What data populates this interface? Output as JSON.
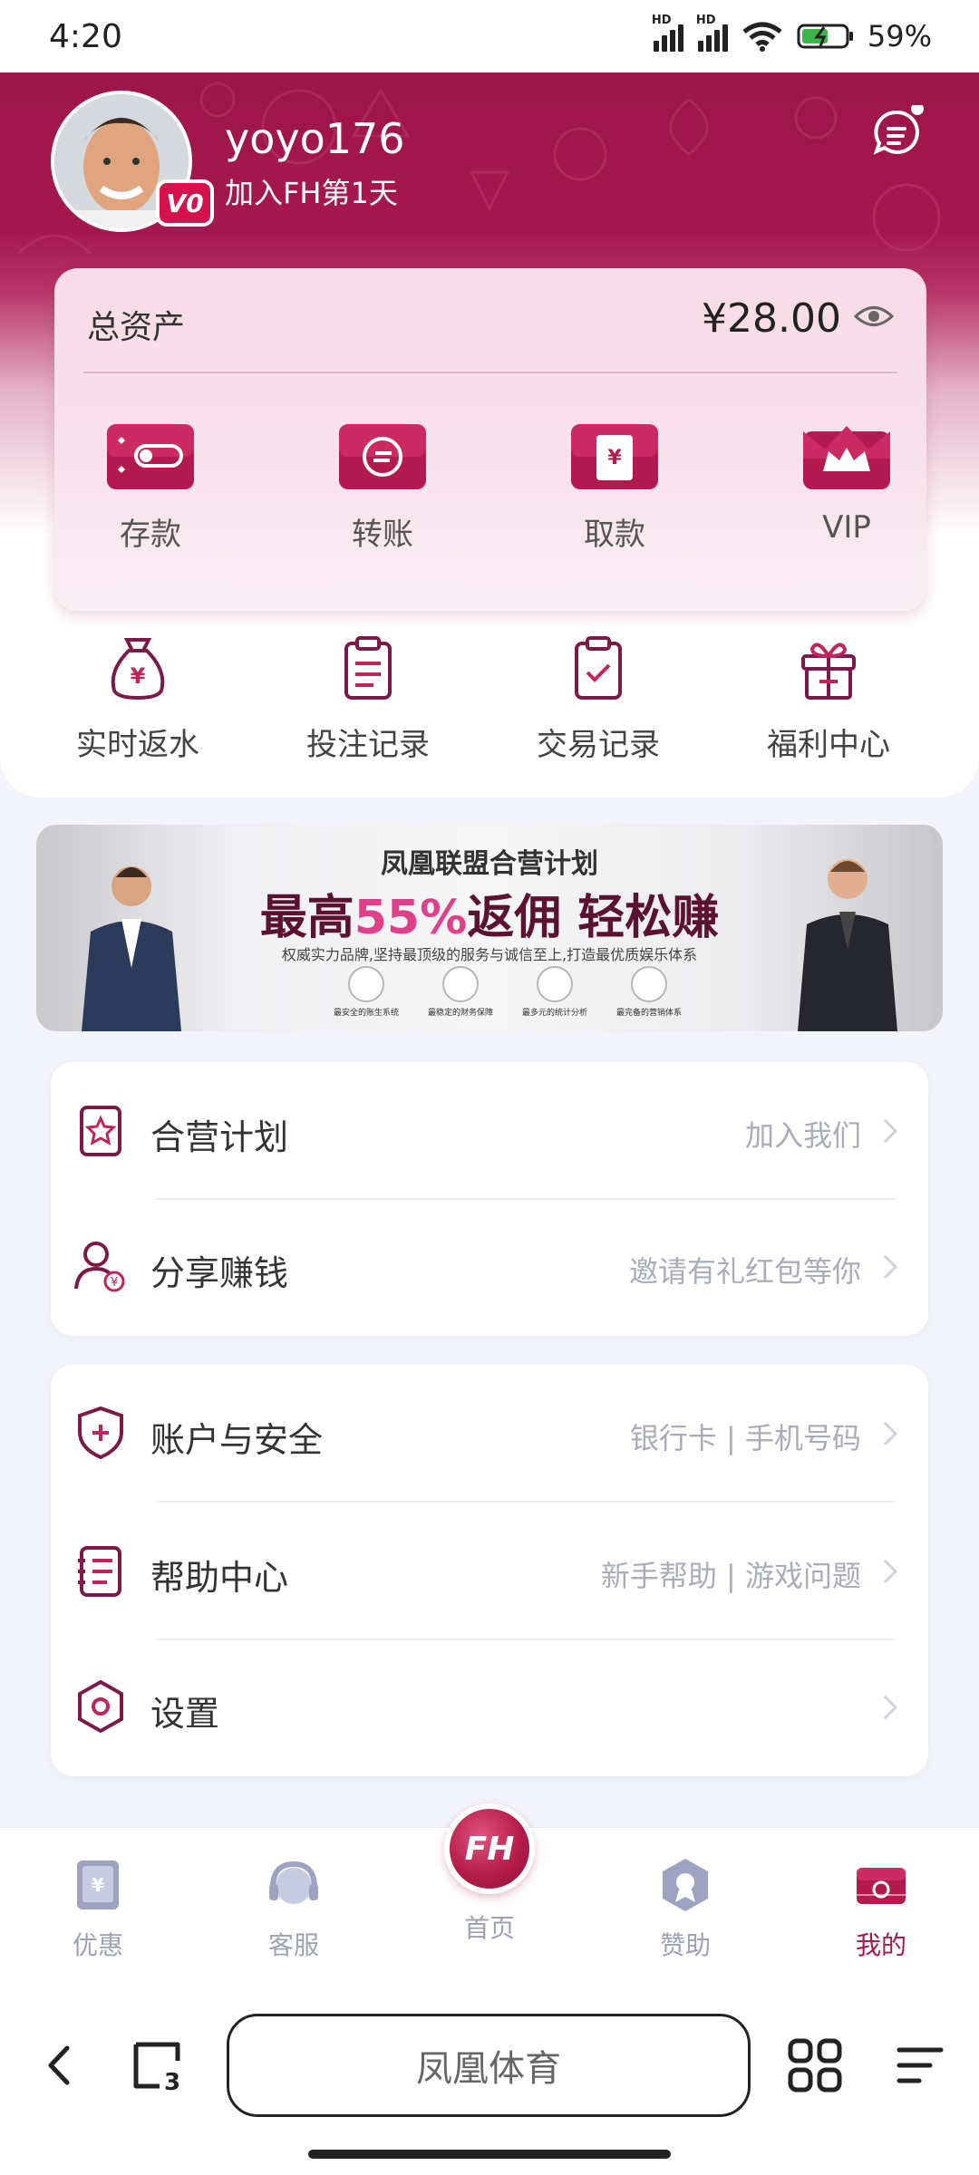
{
  "status_bar": {
    "time": "4:20",
    "battery": "59%",
    "signal_label": "HD"
  },
  "profile": {
    "username": "yoyo176",
    "join_text": "加入FH第1天",
    "vip_badge": "V0"
  },
  "assets": {
    "label": "总资产",
    "amount": "¥28.00"
  },
  "asset_actions": [
    {
      "label": "存款",
      "icon": "deposit-card-icon"
    },
    {
      "label": "转账",
      "icon": "transfer-card-icon"
    },
    {
      "label": "取款",
      "icon": "withdraw-card-icon"
    },
    {
      "label": "VIP",
      "icon": "crown-icon"
    }
  ],
  "quick_links": [
    {
      "label": "实时返水",
      "icon": "money-bag-icon"
    },
    {
      "label": "投注记录",
      "icon": "clipboard-list-icon"
    },
    {
      "label": "交易记录",
      "icon": "clipboard-check-icon"
    },
    {
      "label": "福利中心",
      "icon": "gift-icon"
    }
  ],
  "banner": {
    "title": "凤凰联盟合营计划",
    "main_prefix": "最高",
    "main_highlight": "55%",
    "main_suffix": "返佣 轻松赚",
    "subtitle": "权威实力品牌,坚持最顶级的服务与诚信至上,打造最优质娱乐体系",
    "features": [
      "最安全的账生系统",
      "最稳定的财务保障",
      "最多元的统计分析",
      "最完备的营销体系"
    ]
  },
  "menu_group1": [
    {
      "label": "合营计划",
      "sub": "加入我们",
      "icon": "star-badge-icon"
    },
    {
      "label": "分享赚钱",
      "sub": "邀请有礼红包等你",
      "icon": "user-money-icon"
    }
  ],
  "menu_group2": [
    {
      "label": "账户与安全",
      "sub": "银行卡 | 手机号码",
      "icon": "shield-plus-icon"
    },
    {
      "label": "帮助中心",
      "sub": "新手帮助 | 游戏问题",
      "icon": "help-list-icon"
    },
    {
      "label": "设置",
      "sub": "",
      "icon": "hexagon-settings-icon"
    }
  ],
  "tab_bar": {
    "tabs": [
      {
        "label": "优惠",
        "icon": "discount-icon"
      },
      {
        "label": "客服",
        "icon": "headset-icon"
      },
      {
        "label": "首页",
        "icon": "fh-logo-icon",
        "logo_text": "FH"
      },
      {
        "label": "赞助",
        "icon": "sponsor-icon"
      },
      {
        "label": "我的",
        "icon": "wallet-icon"
      }
    ],
    "active": "我的"
  },
  "browser": {
    "url_text": "凤凰体育",
    "tab_count": "3"
  },
  "colors": {
    "brand": "#a61a4e",
    "accent_pink": "#e0408a",
    "muted_text": "#9ea0b6"
  }
}
